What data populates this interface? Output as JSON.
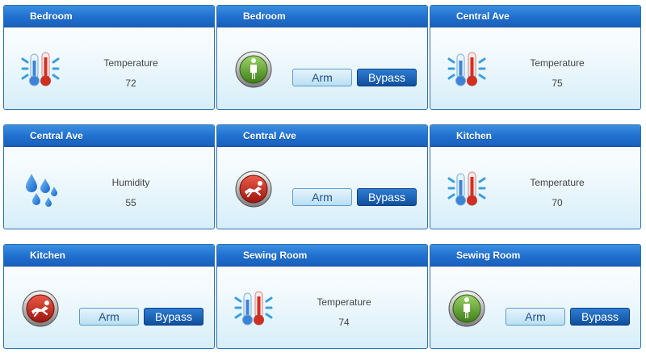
{
  "panels": [
    {
      "title": "Bedroom",
      "kind": "sensor",
      "icon": "temperature-icon",
      "label": "Temperature",
      "value": "72"
    },
    {
      "title": "Bedroom",
      "kind": "zone",
      "icon": "zone-ready-icon",
      "arm_label": "Arm",
      "bypass_label": "Bypass"
    },
    {
      "title": "Central Ave",
      "kind": "sensor",
      "icon": "temperature-icon",
      "label": "Temperature",
      "value": "75"
    },
    {
      "title": "Central Ave",
      "kind": "sensor",
      "icon": "humidity-icon",
      "label": "Humidity",
      "value": "55"
    },
    {
      "title": "Central Ave",
      "kind": "zone",
      "icon": "zone-alarm-icon",
      "arm_label": "Arm",
      "bypass_label": "Bypass"
    },
    {
      "title": "Kitchen",
      "kind": "sensor",
      "icon": "temperature-icon",
      "label": "Temperature",
      "value": "70"
    },
    {
      "title": "Kitchen",
      "kind": "zone",
      "icon": "zone-alarm-icon",
      "arm_label": "Arm",
      "bypass_label": "Bypass"
    },
    {
      "title": "Sewing Room",
      "kind": "sensor",
      "icon": "temperature-icon",
      "label": "Temperature",
      "value": "74"
    },
    {
      "title": "Sewing Room",
      "kind": "zone",
      "icon": "zone-ready-icon",
      "arm_label": "Arm",
      "bypass_label": "Bypass"
    }
  ],
  "colors": {
    "header": "#1f6fcf",
    "border": "#2f6fb2",
    "zone_ready": "#5b9a2a",
    "zone_alarm": "#c0281d",
    "bypass_button": "#1559b0"
  }
}
